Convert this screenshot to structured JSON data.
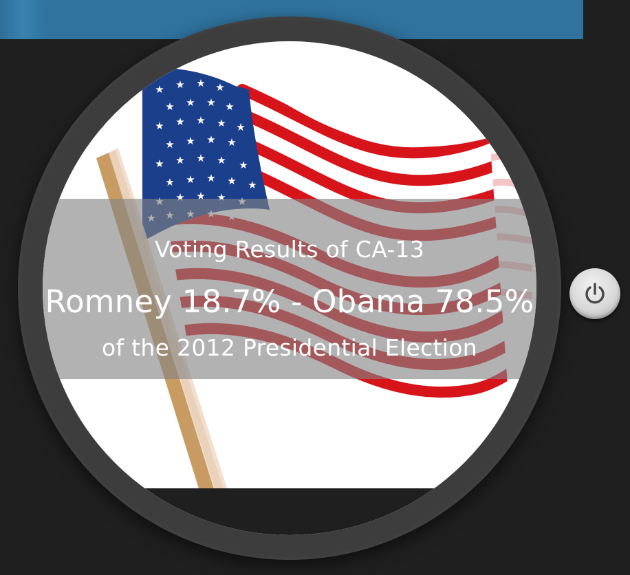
{
  "overlay": {
    "title": "Voting Results of CA-13",
    "result": "Romney 18.7% - Obama 78.5%",
    "subtitle": "of the 2012 Presidential Election"
  },
  "icons": {
    "power": "power-icon",
    "flag": "american-flag-icon"
  },
  "colors": {
    "top_bar": "#2f739e",
    "background": "#1f1f1f",
    "bezel": "#3d3d3d",
    "flag_red": "#d8141b",
    "flag_blue": "#1c3f8c",
    "pole": "#c89b62",
    "overlay_band": "#828282"
  }
}
